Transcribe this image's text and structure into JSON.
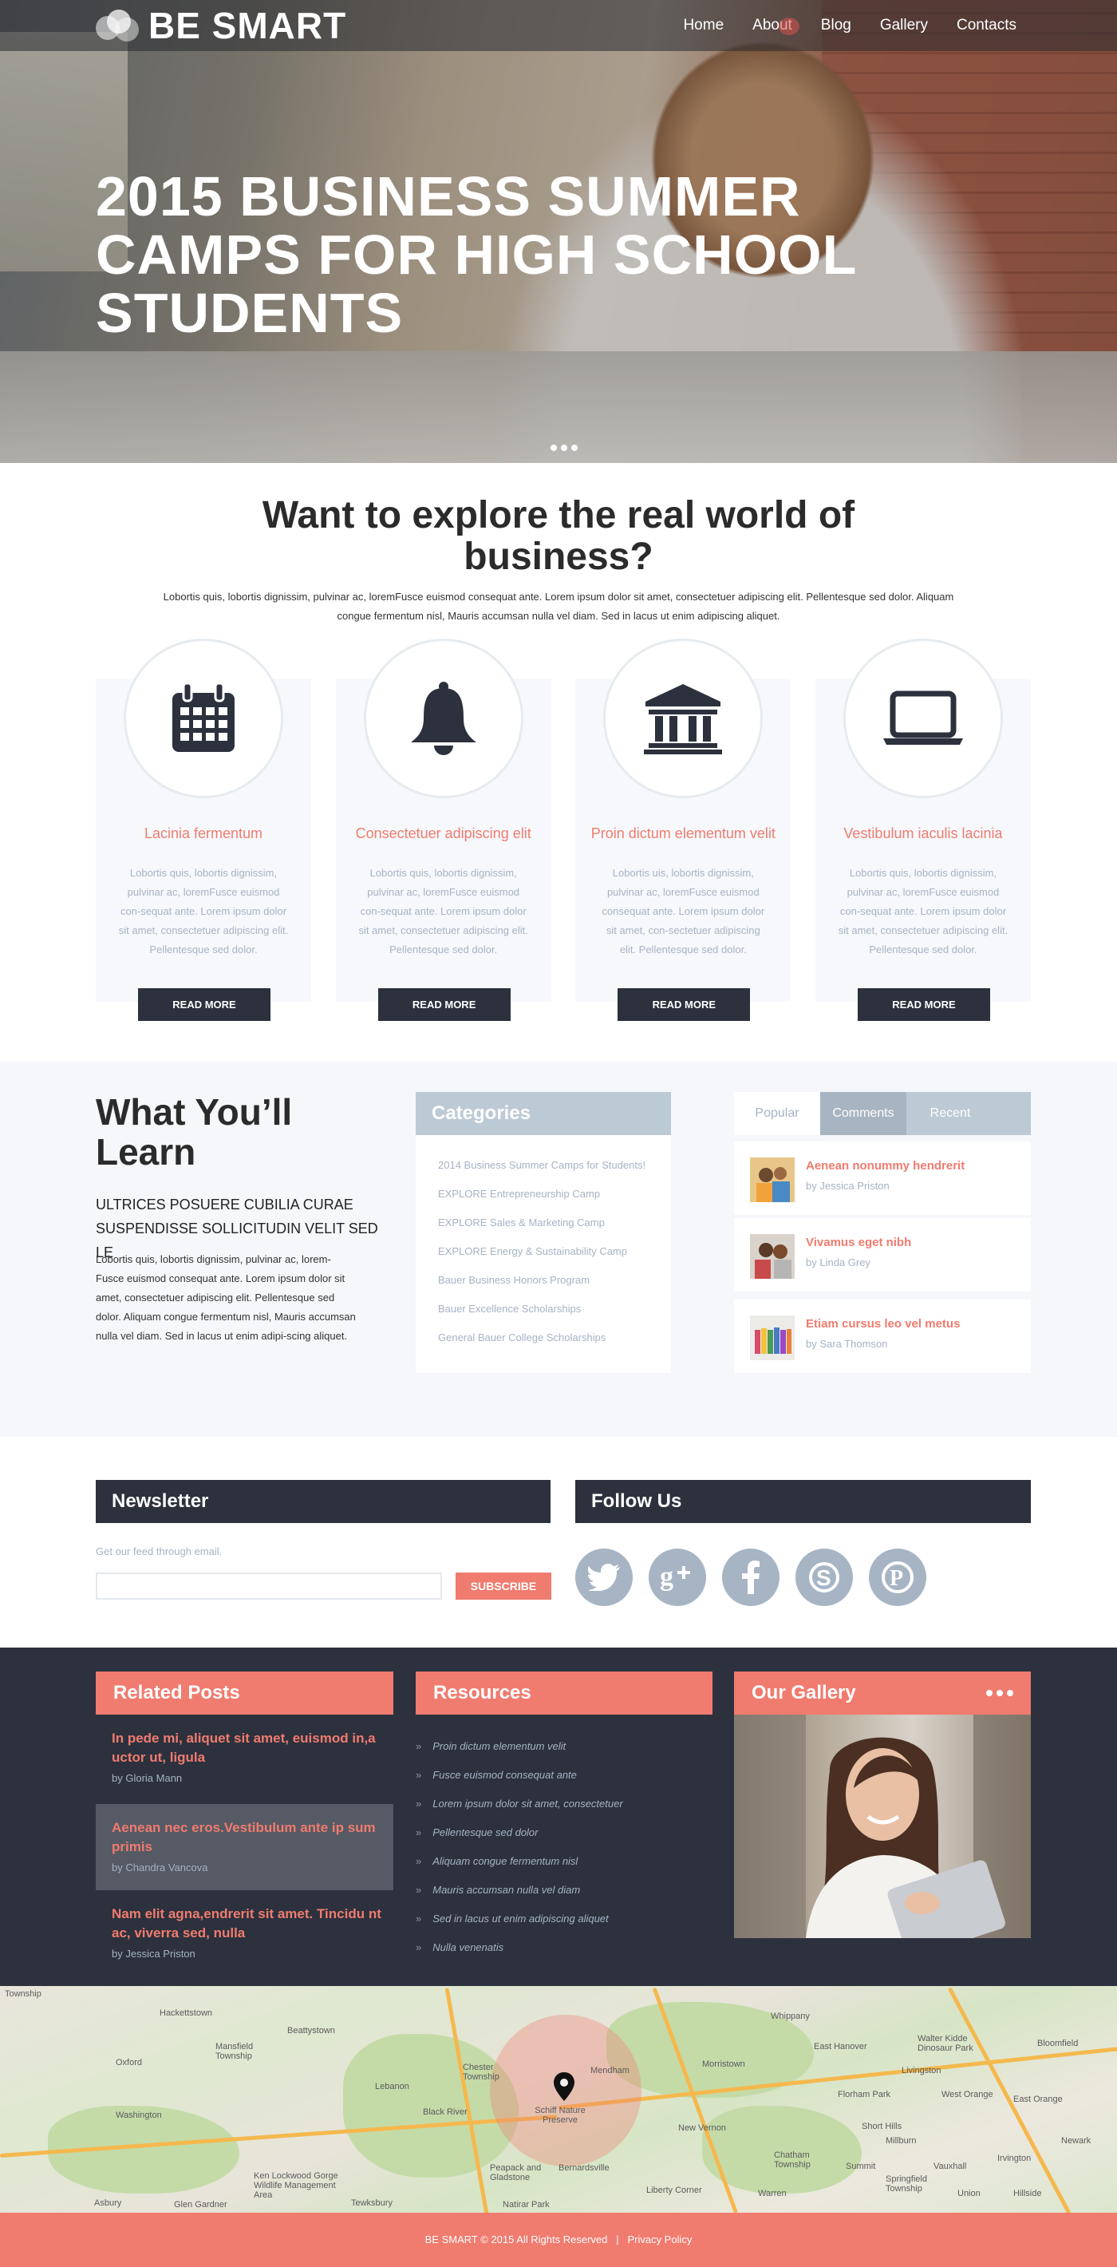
{
  "site": {
    "logo": "BE SMART",
    "nav": [
      "Home",
      "About",
      "Blog",
      "Gallery",
      "Contacts"
    ]
  },
  "hero": {
    "title": "2015 BUSINESS SUMMER CAMPS FOR HIGH SCHOOL STUDENTS"
  },
  "explore": {
    "title": "Want to explore the real world of business?",
    "text": "Lobortis quis, lobortis dignissim, pulvinar ac, loremFusce euismod consequat ante. Lorem ipsum dolor sit amet, consectetuer adipiscing elit. Pellentesque sed dolor. Aliquam congue fermentum nisl, Mauris accumsan nulla vel diam. Sed in lacus ut enim adipiscing aliquet.",
    "features": [
      {
        "icon": "calendar-icon",
        "title": "Lacinia fermentum",
        "text": "Lobortis quis, lobortis dignissim, pulvinar ac, loremFusce euismod con-sequat ante. Lorem ipsum dolor sit amet, consectetuer adipiscing elit. Pellentesque sed dolor.",
        "button": "READ MORE"
      },
      {
        "icon": "bell-icon",
        "title": "Consectetuer adipiscing elit",
        "text": "Lobortis quis, lobortis dignissim, pulvinar ac, loremFusce euismod con-sequat ante. Lorem ipsum dolor sit amet, consectetuer adipiscing elit. Pellentesque sed dolor.",
        "button": "READ MORE"
      },
      {
        "icon": "bank-icon",
        "title": "Proin dictum elementum velit",
        "text": "Lobortis uis, lobortis dignissim, pulvinar ac, loremFusce euismod consequat ante. Lorem ipsum dolor sit amet, con-sectetuer adipiscing elit. Pellentesque sed dolor.",
        "button": "READ MORE"
      },
      {
        "icon": "laptop-icon",
        "title": "Vestibulum iaculis lacinia",
        "text": "Lobortis quis, lobortis dignissim, pulvinar ac, loremFusce euismod con-sequat ante. Lorem ipsum dolor sit amet, consectetuer adipiscing elit. Pellentesque sed dolor.",
        "button": "READ MORE"
      }
    ]
  },
  "learn": {
    "title": "What You’ll Learn",
    "subtitle": "ULTRICES POSUERE CUBILIA CURAE SUSPENDISSE SOLLICITUDIN VELIT SED LE",
    "text": "Lobortis quis, lobortis dignissim, pulvinar ac, lorem-Fusce euismod consequat ante. Lorem ipsum dolor sit amet, consectetuer adipiscing elit. Pellentesque sed dolor. Aliquam congue fermentum nisl, Mauris accumsan nulla vel diam. Sed in lacus ut enim adipi-scing aliquet."
  },
  "categories": {
    "title": "Categories",
    "items": [
      "2014 Business Summer Camps for Students!",
      "EXPLORE Entrepreneurship Camp",
      "EXPLORE Sales & Marketing Camp",
      "EXPLORE Energy & Sustainability Camp",
      "Bauer Business Honors Program",
      "Bauer Excellence Scholarships",
      "General Bauer College Scholarships"
    ]
  },
  "tabs": {
    "labels": [
      "Popular",
      "Comments",
      "Recent"
    ],
    "posts": [
      {
        "title": "Aenean nonummy hendrerit",
        "by": "by Jessica Priston"
      },
      {
        "title": "Vivamus eget nibh",
        "by": "by Linda Grey"
      },
      {
        "title": "Etiam cursus leo vel metus",
        "by": "by Sara Thomson"
      }
    ]
  },
  "newsletter": {
    "title": "Newsletter",
    "note": "Get our feed through email.",
    "input_value": "",
    "button": "SUBSCRIBE"
  },
  "follow": {
    "title": "Follow Us",
    "icons": [
      "twitter-icon",
      "google-plus-icon",
      "facebook-icon",
      "skype-icon",
      "pinterest-icon"
    ]
  },
  "related": {
    "title": "Related Posts",
    "posts": [
      {
        "title": "In pede mi, aliquet sit amet, euismod in,a uctor ut, ligula",
        "by": "by Gloria Mann"
      },
      {
        "title": "Aenean nec eros.Vestibulum ante ip sum primis",
        "by": "by Chandra Vancova"
      },
      {
        "title": "Nam elit agna,endrerit sit amet. Tincidu nt ac, viverra sed, nulla",
        "by": "by Jessica Priston"
      }
    ]
  },
  "resources": {
    "title": "Resources",
    "items": [
      "Proin dictum elementum velit",
      "Fusce euismod consequat ante",
      "Lorem ipsum dolor sit amet, consectetuer",
      "Pellentesque sed dolor",
      "Aliquam congue fermentum nisl",
      "Mauris accumsan nulla vel diam",
      "Sed in lacus ut enim adipiscing aliquet",
      "Nulla venenatis"
    ]
  },
  "gallery": {
    "title": "Our Gallery"
  },
  "map": {
    "labels": [
      "Township",
      "Mansfield Township",
      "Beattystown",
      "Hackettstown",
      "Oxford",
      "Washington",
      "Chester Township",
      "Schiff Nature Preserve",
      "Mendham",
      "Black River",
      "Morristown",
      "Whippany",
      "East Hanover",
      "Livingston",
      "West Orange",
      "East Orange",
      "Newark",
      "Bloomfield",
      "Millburn",
      "Summit",
      "Union",
      "Chatham Township",
      "Springfield Township",
      "New Vernon",
      "Bernardsville",
      "Liberty Corner",
      "Warren",
      "Peapack and Gladstone",
      "Natirar Park",
      "Ken Lockwood Gorge Wildlife Management Area",
      "Asbury",
      "Glen Gardner",
      "Tewksbury",
      "Lebanon",
      "Walter Kidde Dinosaur Park",
      "Florham Park",
      "Short Hills",
      "Vauxhall",
      "Irvington",
      "Hillside"
    ]
  },
  "footer": {
    "copyright": "BE SMART © 2015 All Rights Reserved",
    "separator": "|",
    "privacy": "Privacy Policy"
  },
  "colors": {
    "accent": "#f07b6f",
    "dark": "#2c313d",
    "muted": "#a7b2c3",
    "panel": "#bccad6"
  }
}
